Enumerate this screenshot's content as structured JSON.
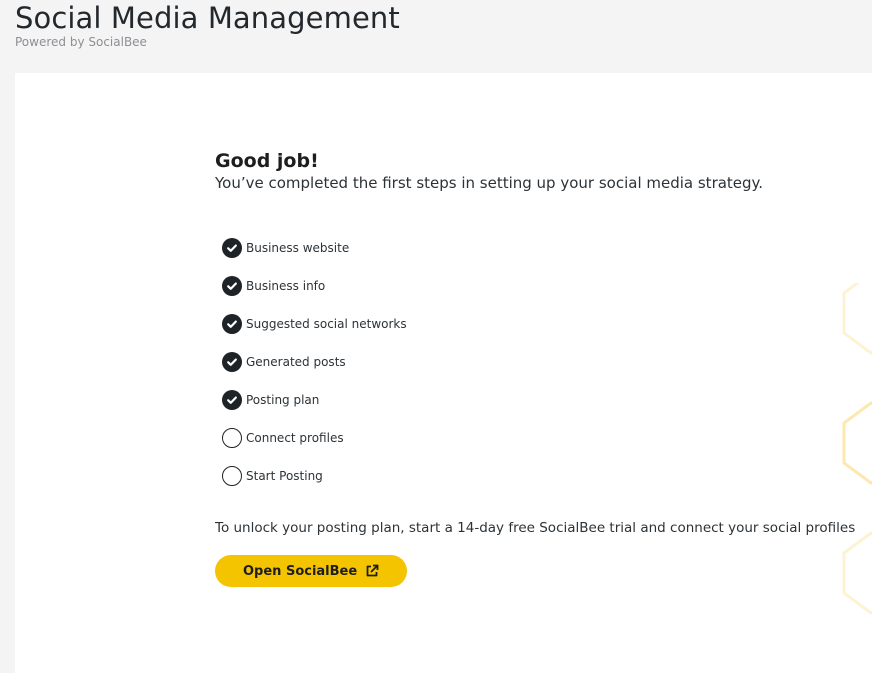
{
  "header": {
    "title": "Social Media Management",
    "powered_by": "Powered by SocialBee"
  },
  "main": {
    "heading": "Good job!",
    "subheading": "You’ve completed the first steps in setting up your social media strategy.",
    "steps": [
      {
        "label": "Business website",
        "done": true
      },
      {
        "label": "Business info",
        "done": true
      },
      {
        "label": "Suggested social networks",
        "done": true
      },
      {
        "label": "Generated posts",
        "done": true
      },
      {
        "label": "Posting plan",
        "done": true
      },
      {
        "label": "Connect profiles",
        "done": false
      },
      {
        "label": "Start Posting",
        "done": false
      }
    ],
    "cta_text": "To unlock your posting plan, start a 14-day free SocialBee trial and connect your social profiles",
    "cta_button": {
      "label": "Open SocialBee",
      "icon": "external-link-icon"
    }
  },
  "colors": {
    "accent": "#f5c400",
    "check_fill": "#1d2327",
    "card_bg": "#ffffff",
    "page_bg": "#f4f4f4"
  }
}
